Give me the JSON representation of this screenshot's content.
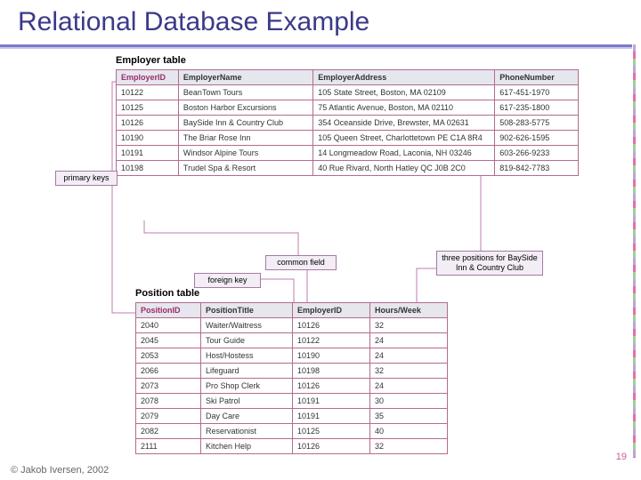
{
  "title": "Relational Database Example",
  "footer": "© Jakob Iversen, 2002",
  "page_number": "19",
  "labels": {
    "primary_keys": "primary keys",
    "common_field": "common field",
    "foreign_key": "foreign key",
    "three_positions": "three positions for BaySide Inn & Country Club"
  },
  "employer_table": {
    "name": "Employer table",
    "columns": [
      "EmployerID",
      "EmployerName",
      "EmployerAddress",
      "PhoneNumber"
    ],
    "rows": [
      [
        "10122",
        "BeanTown Tours",
        "105 State Street, Boston, MA 02109",
        "617-451-1970"
      ],
      [
        "10125",
        "Boston Harbor Excursions",
        "75 Atlantic Avenue, Boston, MA 02110",
        "617-235-1800"
      ],
      [
        "10126",
        "BaySide Inn & Country Club",
        "354 Oceanside Drive, Brewster, MA 02631",
        "508-283-5775"
      ],
      [
        "10190",
        "The Briar Rose Inn",
        "105 Queen Street, Charlottetown PE C1A 8R4",
        "902-626-1595"
      ],
      [
        "10191",
        "Windsor Alpine Tours",
        "14 Longmeadow Road, Laconia, NH 03246",
        "603-266-9233"
      ],
      [
        "10198",
        "Trudel Spa & Resort",
        "40 Rue Rivard, North Hatley QC J0B 2C0",
        "819-842-7783"
      ]
    ]
  },
  "position_table": {
    "name": "Position table",
    "columns": [
      "PositionID",
      "PositionTitle",
      "EmployerID",
      "Hours/Week"
    ],
    "rows": [
      [
        "2040",
        "Waiter/Waitress",
        "10126",
        "32"
      ],
      [
        "2045",
        "Tour Guide",
        "10122",
        "24"
      ],
      [
        "2053",
        "Host/Hostess",
        "10190",
        "24"
      ],
      [
        "2066",
        "Lifeguard",
        "10198",
        "32"
      ],
      [
        "2073",
        "Pro Shop Clerk",
        "10126",
        "24"
      ],
      [
        "2078",
        "Ski Patrol",
        "10191",
        "30"
      ],
      [
        "2079",
        "Day Care",
        "10191",
        "35"
      ],
      [
        "2082",
        "Reservationist",
        "10125",
        "40"
      ],
      [
        "2111",
        "Kitchen Help",
        "10126",
        "32"
      ]
    ]
  }
}
